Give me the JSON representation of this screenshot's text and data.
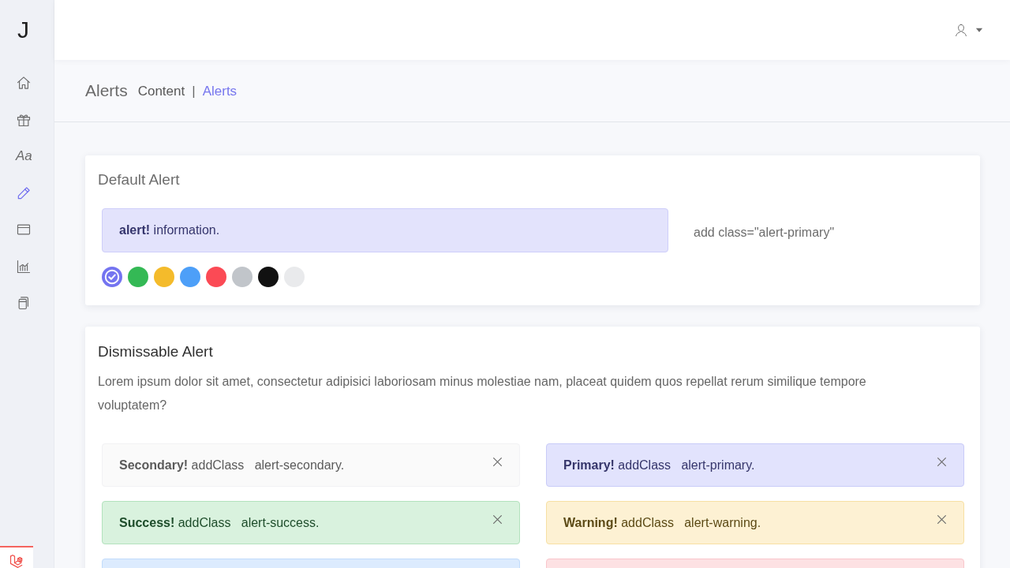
{
  "sidebar": {
    "logo": "J",
    "items": [
      {
        "kind": "home",
        "selected": false
      },
      {
        "kind": "gift",
        "selected": false
      },
      {
        "kind": "glyph",
        "label": "Aa",
        "selected": false
      },
      {
        "kind": "pencil",
        "selected": true
      },
      {
        "kind": "window",
        "selected": false
      },
      {
        "kind": "chart",
        "selected": false
      },
      {
        "kind": "pages",
        "selected": false
      }
    ]
  },
  "page_header": {
    "title": "Alerts",
    "breadcrumb": {
      "items": [
        {
          "label": "Content",
          "selected": false
        },
        {
          "label": "Alerts",
          "selected": true
        }
      ],
      "separator": "|"
    }
  },
  "default_alert_card": {
    "title": "Default Alert",
    "alert": {
      "text": "**alert!** information."
    },
    "note": "add class=\"alert-primary\"",
    "swatches": [
      {
        "color": "#7474f0",
        "selected": true
      },
      {
        "color": "#34b955",
        "selected": false
      },
      {
        "color": "#f4bb2b",
        "selected": false
      },
      {
        "color": "#4d9ff8",
        "selected": false
      },
      {
        "color": "#fb4a55",
        "selected": false
      },
      {
        "color": "#c1c5ca",
        "selected": false
      },
      {
        "color": "#111111",
        "selected": false
      },
      {
        "color": "#e9eaec",
        "selected": false
      }
    ]
  },
  "dismissable_alert_card": {
    "title": "Dismissable Alert",
    "description": "Lorem ipsum dolor sit amet, consectetur adipisici laboriosam minus molestiae nam, placeat quidem quos repellat rerum similique tempore voluptatem?",
    "alerts": [
      {
        "kind": "secondary",
        "text": "**Secondary!** addClass   alert-secondary."
      },
      {
        "kind": "primary",
        "text": "**Primary!** addClass   alert-primary."
      },
      {
        "kind": "success",
        "text": "**Success!** addClass   alert-success."
      },
      {
        "kind": "warning",
        "text": "**Warning!** addClass   alert-warning."
      },
      {
        "kind": "info"
      },
      {
        "kind": "danger"
      }
    ]
  }
}
